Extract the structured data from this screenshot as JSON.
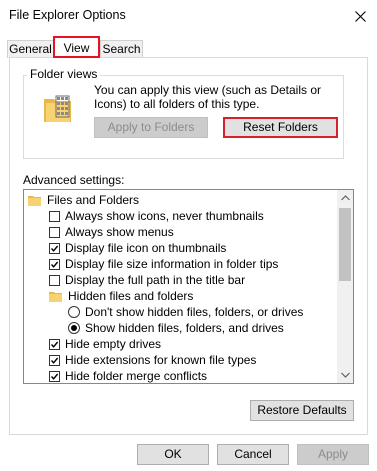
{
  "window": {
    "title": "File Explorer Options",
    "close_icon": "close-icon"
  },
  "tabs": [
    {
      "label": "General",
      "active": false
    },
    {
      "label": "View",
      "active": true
    },
    {
      "label": "Search",
      "active": false
    }
  ],
  "folder_views": {
    "legend": "Folder views",
    "description": "You can apply this view (such as Details or Icons) to all folders of this type.",
    "apply_label": "Apply to Folders",
    "reset_label": "Reset Folders"
  },
  "advanced": {
    "label": "Advanced settings:",
    "items": [
      {
        "type": "folder",
        "label": "Files and Folders",
        "indent": 0
      },
      {
        "type": "checkbox",
        "label": "Always show icons, never thumbnails",
        "checked": false,
        "indent": 1
      },
      {
        "type": "checkbox",
        "label": "Always show menus",
        "checked": false,
        "indent": 1
      },
      {
        "type": "checkbox",
        "label": "Display file icon on thumbnails",
        "checked": true,
        "indent": 1
      },
      {
        "type": "checkbox",
        "label": "Display file size information in folder tips",
        "checked": true,
        "indent": 1
      },
      {
        "type": "checkbox",
        "label": "Display the full path in the title bar",
        "checked": false,
        "indent": 1
      },
      {
        "type": "folder",
        "label": "Hidden files and folders",
        "indent": 1
      },
      {
        "type": "radio",
        "label": "Don't show hidden files, folders, or drives",
        "checked": false,
        "indent": 2
      },
      {
        "type": "radio",
        "label": "Show hidden files, folders, and drives",
        "checked": true,
        "indent": 2
      },
      {
        "type": "checkbox",
        "label": "Hide empty drives",
        "checked": true,
        "indent": 1
      },
      {
        "type": "checkbox",
        "label": "Hide extensions for known file types",
        "checked": true,
        "indent": 1
      },
      {
        "type": "checkbox",
        "label": "Hide folder merge conflicts",
        "checked": true,
        "indent": 1
      }
    ],
    "restore_label": "Restore Defaults"
  },
  "footer": {
    "ok_label": "OK",
    "cancel_label": "Cancel",
    "apply_label": "Apply"
  }
}
